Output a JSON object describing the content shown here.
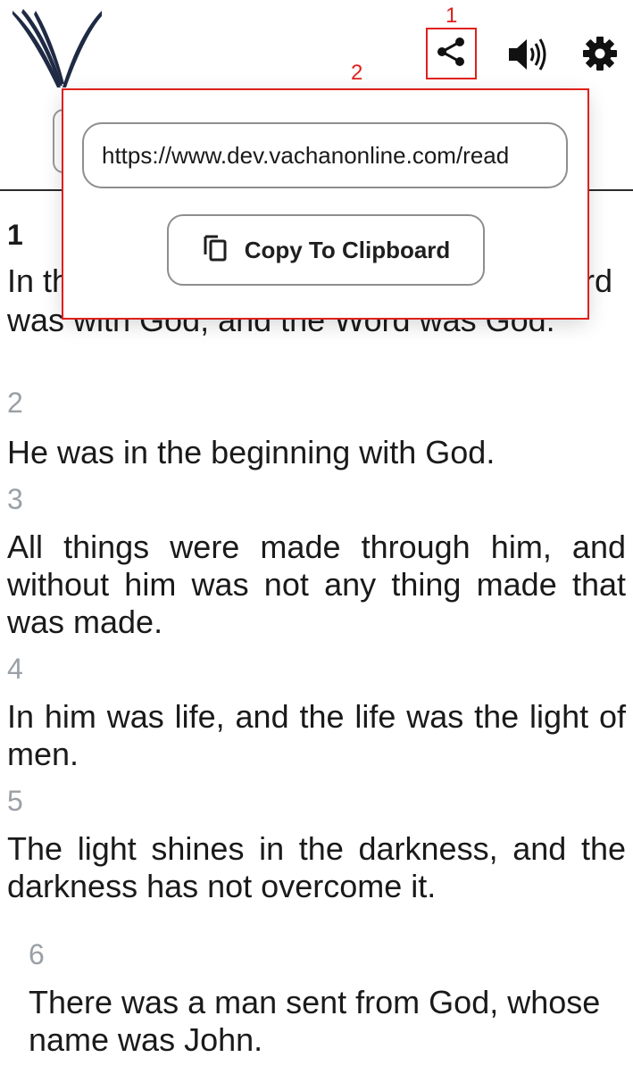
{
  "annotations": {
    "one": "1",
    "two": "2"
  },
  "share_popover": {
    "url": "https://www.dev.vachanonline.com/read",
    "copy_label": "Copy To Clipboard"
  },
  "icons": [
    "vachan-logo",
    "share-icon",
    "speaker-icon",
    "gear-icon",
    "copy-icon"
  ],
  "verses": [
    {
      "num": "1",
      "text": "was with God, and the Word was God.",
      "partial_left": "In th",
      "partial_right": "ord"
    },
    {
      "num": "2",
      "text": "He was in the beginning with God."
    },
    {
      "num": "3",
      "text": "All things were made through him, and without him was not any thing made that was made."
    },
    {
      "num": "4",
      "text": "In him was life, and the life was the light of men."
    },
    {
      "num": "5",
      "text": "The light shines in the darkness, and the darkness has not overcome it."
    },
    {
      "num": "6",
      "text": "There was a man sent from God, whose name was John."
    }
  ],
  "colors": {
    "annotation": "#e0201c",
    "logo": "#1f2a44",
    "verse_number": "#9aa0a6"
  }
}
